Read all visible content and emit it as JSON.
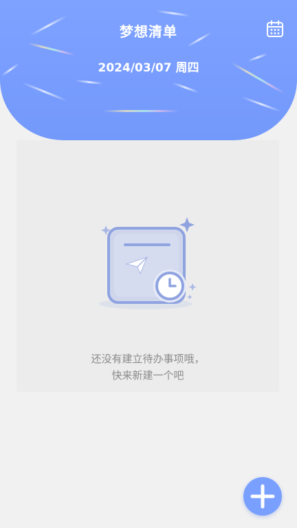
{
  "header": {
    "title": "梦想清单",
    "date": "2024/03/07 周四",
    "calendar_icon": "calendar-icon"
  },
  "empty_state": {
    "illustration_icon": "todo-clock-illustration-icon",
    "line1": "还没有建立待办事项哦，",
    "line2": "快来新建一个吧"
  },
  "fab": {
    "icon": "plus-icon"
  },
  "colors": {
    "header": "#7ea2ff",
    "accent": "#7aa0ff",
    "background": "#f1f1f1",
    "card": "#ececec",
    "text_muted": "#8a8a8a"
  }
}
